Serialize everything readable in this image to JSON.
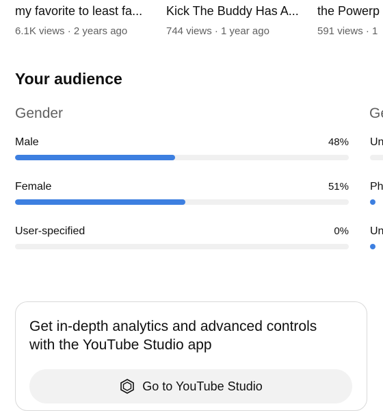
{
  "recent_videos": [
    {
      "title": "my favorite to least fa...",
      "meta": "6.1K views · 2 years ago"
    },
    {
      "title": "Kick The Buddy Has A...",
      "meta": "744 views · 1 year ago"
    },
    {
      "title": "the Powerp",
      "meta": "591 views · 1"
    }
  ],
  "audience": {
    "section_title": "Your audience",
    "gender": {
      "heading": "Gender",
      "rows": [
        {
          "label": "Male",
          "percent_text": "48%",
          "percent": 48
        },
        {
          "label": "Female",
          "percent_text": "51%",
          "percent": 51
        },
        {
          "label": "User-specified",
          "percent_text": "0%",
          "percent": 0
        }
      ]
    },
    "second_card": {
      "heading": "Ge",
      "row_labels": [
        "Un",
        "Ph",
        "Un"
      ]
    }
  },
  "studio_promo": {
    "text": "Get in-depth analytics and advanced controls with the YouTube Studio app",
    "button_label": "Go to YouTube Studio"
  },
  "colors": {
    "accent": "#3d7fe0",
    "track": "#f0f0f0",
    "secondary_text": "#606060"
  }
}
